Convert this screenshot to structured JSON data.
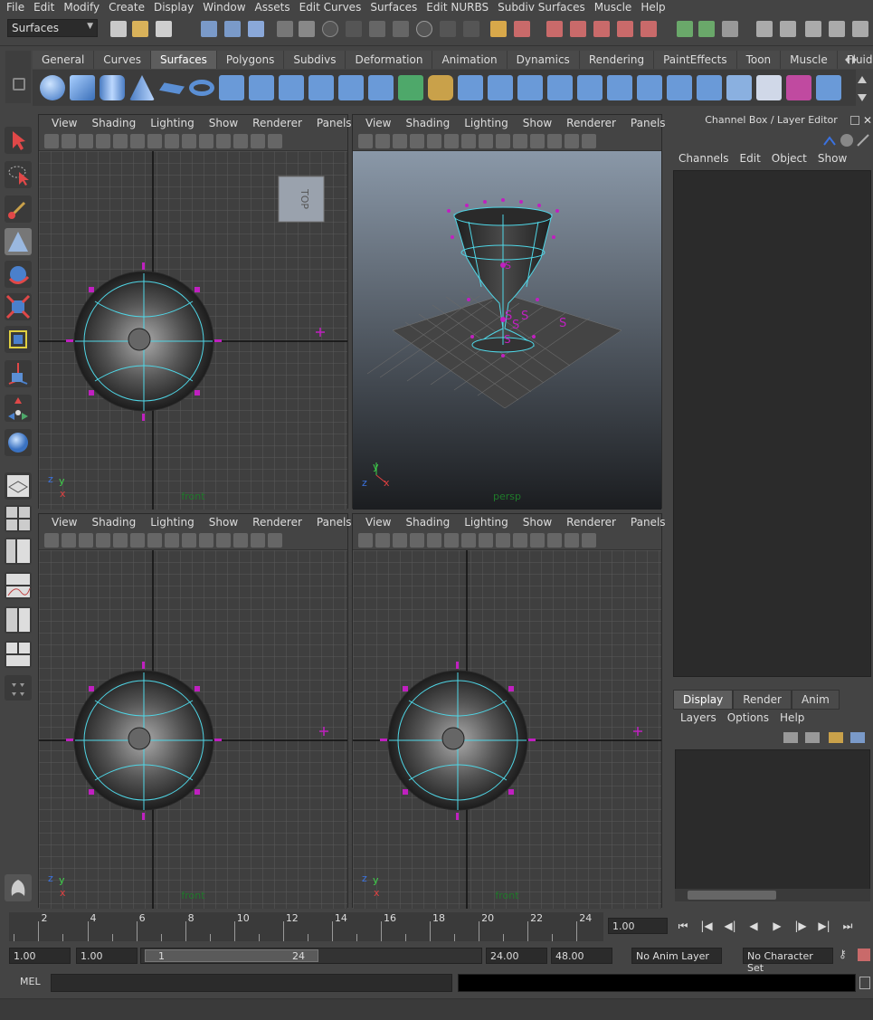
{
  "menubar": [
    "File",
    "Edit",
    "Modify",
    "Create",
    "Display",
    "Window",
    "Assets",
    "Edit Curves",
    "Surfaces",
    "Edit NURBS",
    "Subdiv Surfaces",
    "Muscle",
    "Help"
  ],
  "status": {
    "mode": "Surfaces"
  },
  "shelf": {
    "tabs": [
      "General",
      "Curves",
      "Surfaces",
      "Polygons",
      "Subdivs",
      "Deformation",
      "Animation",
      "Dynamics",
      "Rendering",
      "PaintEffects",
      "Toon",
      "Muscle",
      "Fluids"
    ],
    "active": "Surfaces"
  },
  "viewport_menu": [
    "View",
    "Shading",
    "Lighting",
    "Show",
    "Renderer",
    "Panels"
  ],
  "viewports": {
    "top": {
      "label": "front",
      "cube": "TOP"
    },
    "persp": {
      "label": "persp"
    },
    "front": {
      "label": "front"
    },
    "side": {
      "label": "front"
    }
  },
  "axis": {
    "x": "x",
    "y": "y",
    "z": "z"
  },
  "channelbox": {
    "title": "Channel Box / Layer Editor",
    "menu": [
      "Channels",
      "Edit",
      "Object",
      "Show"
    ]
  },
  "layers": {
    "tabs": [
      "Display",
      "Render",
      "Anim"
    ],
    "active": "Display",
    "menu": [
      "Layers",
      "Options",
      "Help"
    ]
  },
  "timeslider": {
    "ticks": [
      "2",
      "4",
      "6",
      "8",
      "10",
      "12",
      "14",
      "16",
      "18",
      "20",
      "22",
      "24"
    ],
    "current": "1.00"
  },
  "range": {
    "start": "1.00",
    "playback_start": "1.00",
    "thumb_start": "1",
    "thumb_end": "24",
    "playback_end": "24.00",
    "end": "48.00",
    "anim_layer": "No Anim Layer",
    "char_set": "No Character Set"
  },
  "cmd": {
    "label": "MEL"
  },
  "colors": {
    "wire": "#4fd6e6",
    "cv": "#c020c0",
    "grid": "#5a5a5a"
  }
}
